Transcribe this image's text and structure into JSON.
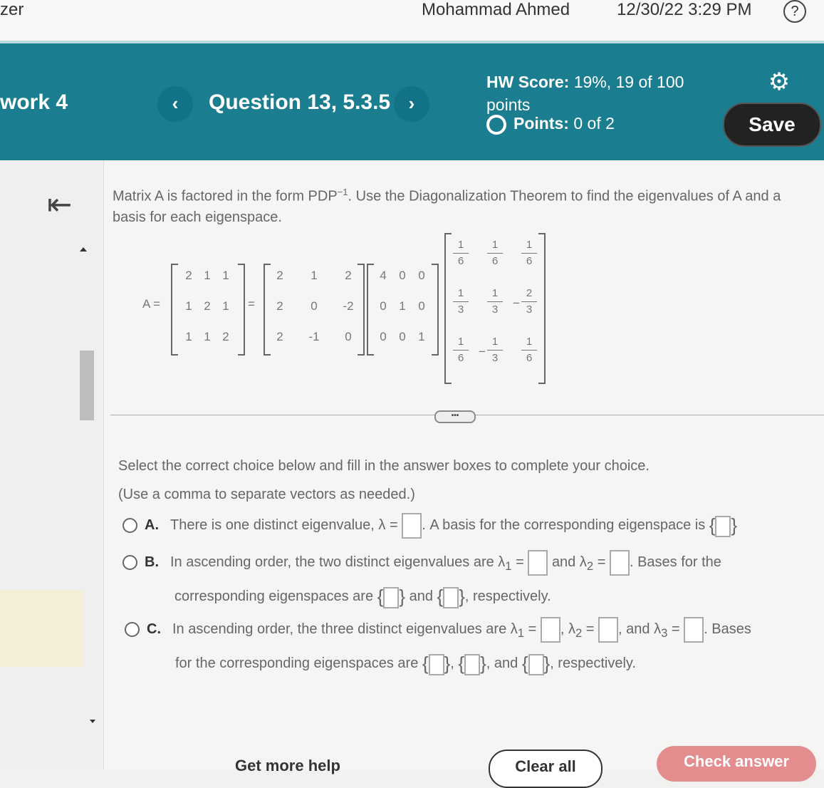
{
  "topbar": {
    "app_name": "zer",
    "user_name": "Mohammad Ahmed",
    "timestamp": "12/30/22 3:29 PM",
    "help_icon": "?"
  },
  "header": {
    "homework_title": "work 4",
    "question_title": "Question 13, 5.3.5",
    "prev_icon": "‹",
    "next_icon": "›",
    "hw_score_label": "HW Score:",
    "hw_score_value": "19%, 19 of 100 points",
    "points_label": "Points:",
    "points_value": "0 of 2",
    "save_label": "Save",
    "settings_icon": "⚙"
  },
  "problem": {
    "prompt_part1": "Matrix A is factored in the form PDP",
    "prompt_exponent": "−1",
    "prompt_part2": ". Use the Diagonalization Theorem to find the eigenvalues of A and a basis for each eigenspace.",
    "a_label": "A =",
    "matrix_A": [
      [
        "2",
        "1",
        "1"
      ],
      [
        "1",
        "2",
        "1"
      ],
      [
        "1",
        "1",
        "2"
      ]
    ],
    "matrix_P": [
      [
        "2",
        "1",
        "2"
      ],
      [
        "2",
        "0",
        "-2"
      ],
      [
        "2",
        "-1",
        "0"
      ]
    ],
    "matrix_D": [
      [
        "4",
        "0",
        "0"
      ],
      [
        "0",
        "1",
        "0"
      ],
      [
        "0",
        "0",
        "1"
      ]
    ],
    "matrix_Pinv": [
      [
        {
          "sign": "",
          "num": "1",
          "den": "6"
        },
        {
          "sign": "",
          "num": "1",
          "den": "6"
        },
        {
          "sign": "",
          "num": "1",
          "den": "6"
        }
      ],
      [
        {
          "sign": "",
          "num": "1",
          "den": "3"
        },
        {
          "sign": "",
          "num": "1",
          "den": "3"
        },
        {
          "sign": "−",
          "num": "2",
          "den": "3"
        }
      ],
      [
        {
          "sign": "",
          "num": "1",
          "den": "6"
        },
        {
          "sign": "−",
          "num": "1",
          "den": "3"
        },
        {
          "sign": "",
          "num": "1",
          "den": "6"
        }
      ]
    ],
    "expand_label": "•••"
  },
  "instructions": {
    "line1": "Select the correct choice below and fill in the answer boxes to complete your choice.",
    "line2": "(Use a comma to separate vectors as needed.)"
  },
  "choices": {
    "a": {
      "letter": "A.",
      "text1": "There is one distinct eigenvalue, λ =",
      "text2": ". A basis for the corresponding eigenspace is"
    },
    "b": {
      "letter": "B.",
      "text1": "In ascending order, the two distinct eigenvalues are λ",
      "sub1": "1",
      "eq": " =",
      "text2": "and λ",
      "sub2": "2",
      "text3": ". Bases for the",
      "text4": "corresponding eigenspaces are",
      "text5": "and",
      "text6": ", respectively."
    },
    "c": {
      "letter": "C.",
      "text1": "In ascending order, the three distinct eigenvalues are λ",
      "sub1": "1",
      "eq": " =",
      "text2": ", λ",
      "sub2": "2",
      "text3": ", and λ",
      "sub3": "3",
      "text4": ". Bases",
      "text5": "for the corresponding eigenspaces are",
      "text6": ",",
      "text7": ", and",
      "text8": ", respectively."
    }
  },
  "footer": {
    "get_more_help": "Get more help",
    "clear_all": "Clear all",
    "check_answer": "Check answer"
  }
}
